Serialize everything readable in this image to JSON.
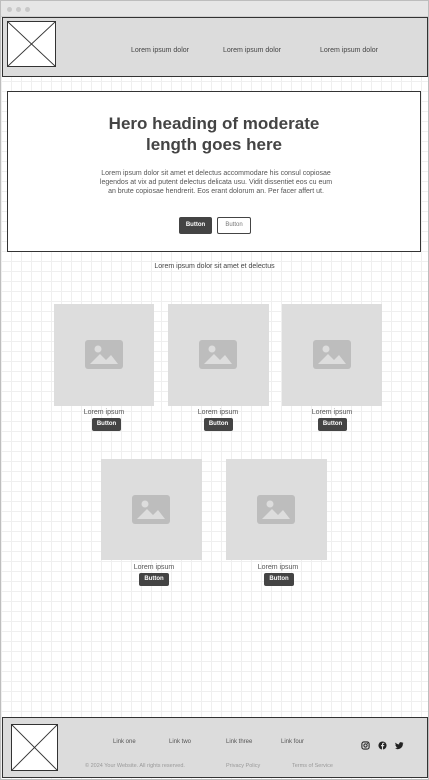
{
  "header": {
    "nav": [
      "Lorem ipsum dolor",
      "Lorem ipsum dolor",
      "Lorem ipsum dolor"
    ]
  },
  "hero": {
    "title_line1": "Hero heading of moderate",
    "title_line2": "length goes here",
    "body": "Lorem ipsum dolor sit amet et delectus accommodare his consul copiosae legendos at vix ad putent delectus delicata usu. Vidit dissentiet eos cu eum an brute copiosae hendrerit. Eos erant dolorum an. Per facer affert ut.",
    "primary_button": "Button",
    "secondary_button": "Button"
  },
  "tagline": "Lorem ipsum dolor sit amet et delectus",
  "cards": [
    {
      "label": "Lorem ipsum",
      "button": "Button"
    },
    {
      "label": "Lorem ipsum",
      "button": "Button"
    },
    {
      "label": "Lorem ipsum",
      "button": "Button"
    },
    {
      "label": "Lorem ipsum",
      "button": "Button"
    },
    {
      "label": "Lorem ipsum",
      "button": "Button"
    }
  ],
  "footer": {
    "links": [
      "Link one",
      "Link two",
      "Link three",
      "Link four"
    ],
    "copyright": "© 2024 Your Website. All rights reserved.",
    "privacy": "Privacy Policy",
    "terms": "Terms of Service",
    "social_icons": [
      "instagram-icon",
      "facebook-icon",
      "twitter-icon"
    ]
  }
}
